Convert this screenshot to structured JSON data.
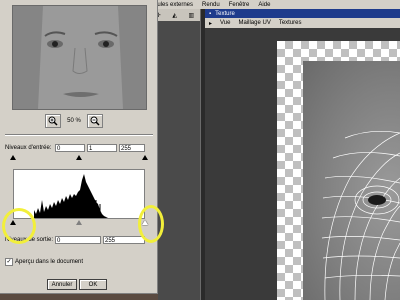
{
  "menubar": {
    "items": [
      "dules externes",
      "Rendu",
      "Fenêtre",
      "Aide"
    ]
  },
  "left_toolbar": {
    "icons": [
      "crosshair-icon",
      "triangle-icon",
      "split-icon"
    ]
  },
  "uv_panel": {
    "title": "Texture",
    "menu": [
      "Vue",
      "Maillage UV",
      "Textures"
    ]
  },
  "dialog": {
    "zoom_value": "50 %",
    "input_levels_label": "Niveaux d'entrée:",
    "input_black": "0",
    "input_gamma": "1",
    "input_white": "255",
    "output_levels_label": "Niveaux de sortie:",
    "output_black": "0",
    "output_white": "255",
    "preview_checkbox_label": "Aperçu dans le document",
    "preview_checked": true,
    "cancel_label": "Annuler",
    "ok_label": "OK"
  },
  "highlight_color": "#f2ef3a"
}
